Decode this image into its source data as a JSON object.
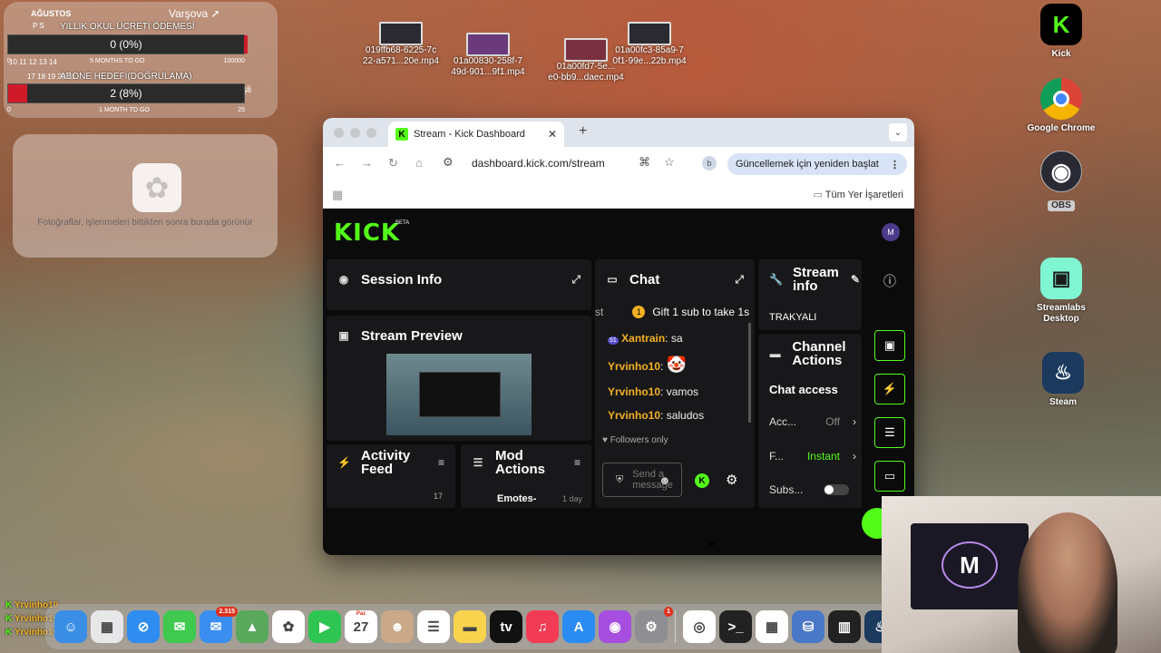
{
  "desktop": {
    "calendar": {
      "month": "AĞUSTOS",
      "days_header": "P S",
      "rows": [
        "10 11 12 13 14",
        "17 18 19 20 21"
      ]
    },
    "weather": {
      "city": "Varşova ➚"
    },
    "goal1": {
      "title": "YILLIK OKUL ÜCRETİ ÖDEMESİ",
      "value_text": "0 (0%)",
      "progress": 0,
      "axis_left": "0",
      "axis_mid": "5 MONTHS TO GO",
      "axis_right": "100000"
    },
    "goal2": {
      "title": "ABONE HEDEFİ(DOĞRULAMA)",
      "value_text": "2 (8%)",
      "progress": 8,
      "axis_left": "0",
      "axis_mid": "1 MONTH TO GO",
      "axis_right": "25"
    },
    "weather_side_text": "eşli",
    "photos_widget": {
      "caption": "Fotoğraflar, işlenmeleri bittikten sonra burada görünür"
    },
    "files": [
      {
        "name_line1": "019ffb68-6225-7c",
        "name_line2": "22-a571...20e.mp4"
      },
      {
        "name_line1": "01a00830-258f-7",
        "name_line2": "49d-901...9f1.mp4"
      },
      {
        "name_line1": "01a00fd7-5e...",
        "name_line2": "e0-bb9...daec.mp4"
      },
      {
        "name_line1": "01a00fc3-85a9-7",
        "name_line2": "0f1-99e...22b.mp4"
      }
    ],
    "icons": [
      {
        "label": "Kick",
        "glyph": "K",
        "color": "#000000",
        "fg": "#53fc18"
      },
      {
        "label": "Google Chrome",
        "glyph": "◎",
        "color": "#ffffff",
        "fg": "#db4437"
      },
      {
        "label": "OBS",
        "glyph": "◉",
        "color": "#1f1f2a",
        "fg": "#ffffff"
      },
      {
        "label": "Streamlabs Desktop",
        "glyph": "▣",
        "color": "#80f5d2",
        "fg": "#1b1b1b"
      },
      {
        "label": "Steam",
        "glyph": "♨",
        "color": "#1b3a5e",
        "fg": "#ffffff"
      }
    ]
  },
  "browser": {
    "tab_title": "Stream - Kick Dashboard",
    "tab_close": "✕",
    "new_tab": "+",
    "dropdown": "⌄",
    "url": "dashboard.kick.com/stream",
    "profile_initial": "b",
    "update_label": "Güncellemek için yeniden başlat",
    "update_dots": "⋮",
    "bookmarks_all": "Tüm Yer İşaretleri"
  },
  "kick": {
    "logo": "KICK",
    "beta": "BETA",
    "user_initial": "M",
    "session_info": "Session Info",
    "stream_preview": "Stream Preview",
    "activity_feed": "Activity Feed",
    "activity_count": "17",
    "mod_actions": "Mod Actions",
    "mod_row": "Emotes-",
    "mod_row_time": "1 day",
    "chat": {
      "title": "Chat",
      "pinned": "Gift 1 sub to take 1s",
      "pinned_prefix": "st",
      "messages": [
        {
          "badge": "51",
          "user": "Xantrain",
          "text": "sa"
        },
        {
          "badge": "",
          "user": "Yrvinho10",
          "text": "🤡"
        },
        {
          "badge": "",
          "user": "Yrvinho10",
          "text": "vamos"
        },
        {
          "badge": "",
          "user": "Yrvinho10",
          "text": "saludos"
        }
      ],
      "mode": "Followers only",
      "placeholder": "Send a message"
    },
    "stream_info": {
      "title": "Stream info",
      "value": "TRAKYALI"
    },
    "channel_actions": {
      "title": "Channel Actions",
      "section": "Chat access",
      "rows": [
        {
          "label": "Acc...",
          "value": "Off"
        },
        {
          "label": "F...",
          "value": "Instant"
        },
        {
          "label": "Subs...",
          "value": ""
        }
      ]
    }
  },
  "overlay_chat": [
    "Yrvinho10",
    "Yrvinho10",
    "Yrvinho10"
  ],
  "dock": {
    "apps": [
      {
        "name": "Finder",
        "glyph": "☺",
        "bg": "#3a8ee6"
      },
      {
        "name": "Launchpad",
        "glyph": "▦",
        "bg": "#e7e7ea"
      },
      {
        "name": "Safari",
        "glyph": "⊘",
        "bg": "#2f8cf0"
      },
      {
        "name": "Messages",
        "glyph": "✉",
        "bg": "#3fc94e"
      },
      {
        "name": "Mail",
        "glyph": "✉",
        "bg": "#3a8ef0",
        "badge": "2.315"
      },
      {
        "name": "Maps",
        "glyph": "▲",
        "bg": "#5aa85c"
      },
      {
        "name": "Photos",
        "glyph": "✿",
        "bg": "#ffffff"
      },
      {
        "name": "FaceTime",
        "glyph": "▶",
        "bg": "#2fc552"
      },
      {
        "name": "Calendar",
        "glyph": "27",
        "bg": "#ffffff",
        "month": "Paz"
      },
      {
        "name": "Contacts",
        "glyph": "☻",
        "bg": "#c9a98a"
      },
      {
        "name": "Reminders",
        "glyph": "☰",
        "bg": "#ffffff"
      },
      {
        "name": "Notes",
        "glyph": "▬",
        "bg": "#f8d34e"
      },
      {
        "name": "TV",
        "glyph": "tv",
        "bg": "#111111"
      },
      {
        "name": "Music",
        "glyph": "♫",
        "bg": "#f23b55"
      },
      {
        "name": "App Store",
        "glyph": "A",
        "bg": "#2a8cf2"
      },
      {
        "name": "Podcasts",
        "glyph": "◉",
        "bg": "#a54ee0"
      },
      {
        "name": "System Settings",
        "glyph": "⚙",
        "bg": "#8e8e93",
        "badge": "1"
      },
      {
        "name": "Chrome",
        "glyph": "◎",
        "bg": "#ffffff"
      },
      {
        "name": "Terminal",
        "glyph": ">_",
        "bg": "#222222"
      },
      {
        "name": "Spreadsheet",
        "glyph": "▦",
        "bg": "#ffffff"
      },
      {
        "name": "Storage",
        "glyph": "⛁",
        "bg": "#4a78c8"
      },
      {
        "name": "Utility",
        "glyph": "▥",
        "bg": "#222222"
      },
      {
        "name": "Steam",
        "glyph": "♨",
        "bg": "#1b3a5e"
      }
    ]
  }
}
